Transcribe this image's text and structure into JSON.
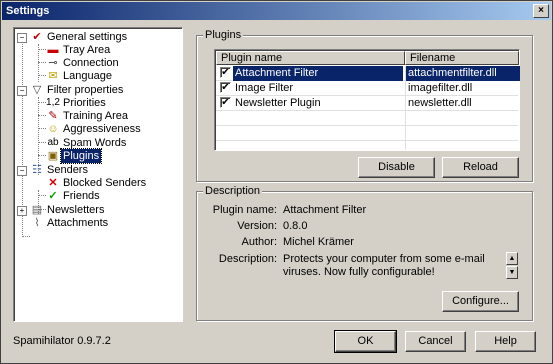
{
  "window": {
    "title": "Settings",
    "close_label": "×"
  },
  "tree": {
    "items": [
      {
        "label": "General settings",
        "icon": "settings-icon",
        "glyph": "✔",
        "color": "#c00000"
      },
      {
        "label": "Tray Area",
        "icon": "tray-icon",
        "glyph": "▬",
        "color": "#cc0000"
      },
      {
        "label": "Connection",
        "icon": "plug-icon",
        "glyph": "⊸",
        "color": "#404040"
      },
      {
        "label": "Language",
        "icon": "language-icon",
        "glyph": "✉",
        "color": "#c0a000"
      },
      {
        "label": "Filter properties",
        "icon": "funnel-icon",
        "glyph": "▽",
        "color": "#404040"
      },
      {
        "label": "Priorities",
        "icon": "priorities-icon",
        "glyph": "1,2",
        "color": "#000000"
      },
      {
        "label": "Training Area",
        "icon": "training-icon",
        "glyph": "✎",
        "color": "#a00000"
      },
      {
        "label": "Aggressiveness",
        "icon": "face-icon",
        "glyph": "☺",
        "color": "#c0a000"
      },
      {
        "label": "Spam Words",
        "icon": "words-icon",
        "glyph": "ab",
        "color": "#000000"
      },
      {
        "label": "Plugins",
        "icon": "plugin-icon",
        "glyph": "▣",
        "color": "#806000"
      },
      {
        "label": "Senders",
        "icon": "senders-icon",
        "glyph": "☷",
        "color": "#4060a0"
      },
      {
        "label": "Blocked Senders",
        "icon": "cross-icon",
        "glyph": "✕",
        "color": "#d00000"
      },
      {
        "label": "Friends",
        "icon": "checkmark-icon",
        "glyph": "✓",
        "color": "#00a000"
      },
      {
        "label": "Newsletters",
        "icon": "newsletter-icon",
        "glyph": "▤",
        "color": "#606060"
      },
      {
        "label": "Attachments",
        "icon": "paperclip-icon",
        "glyph": "⌇",
        "color": "#606060"
      }
    ],
    "expand_minus": "−",
    "expand_plus": "+"
  },
  "plugins": {
    "group_label": "Plugins",
    "columns": [
      "Plugin name",
      "Filename"
    ],
    "rows": [
      {
        "name": "Attachment Filter",
        "file": "attachmentfilter.dll",
        "checked": "✔"
      },
      {
        "name": "Image Filter",
        "file": "imagefilter.dll",
        "checked": "✔"
      },
      {
        "name": "Newsletter Plugin",
        "file": "newsletter.dll",
        "checked": "✔"
      }
    ],
    "disable_label": "Disable",
    "reload_label": "Reload"
  },
  "description": {
    "group_label": "Description",
    "plugin_name_label": "Plugin name:",
    "plugin_name": "Attachment Filter",
    "version_label": "Version:",
    "version": "0.8.0",
    "author_label": "Author:",
    "author": "Michel Krämer",
    "description_label": "Description:",
    "description": "Protects your computer from some e-mail viruses. Now fully configurable!",
    "configure_label": "Configure...",
    "scroll_up": "▲",
    "scroll_down": "▼"
  },
  "footer": {
    "version_text": "Spamihilator 0.9.7.2",
    "ok_label": "OK",
    "cancel_label": "Cancel",
    "help_label": "Help"
  },
  "colors": {
    "selection": "#0a246a",
    "titlebar_start": "#0a246a",
    "titlebar_end": "#a6caf0"
  }
}
